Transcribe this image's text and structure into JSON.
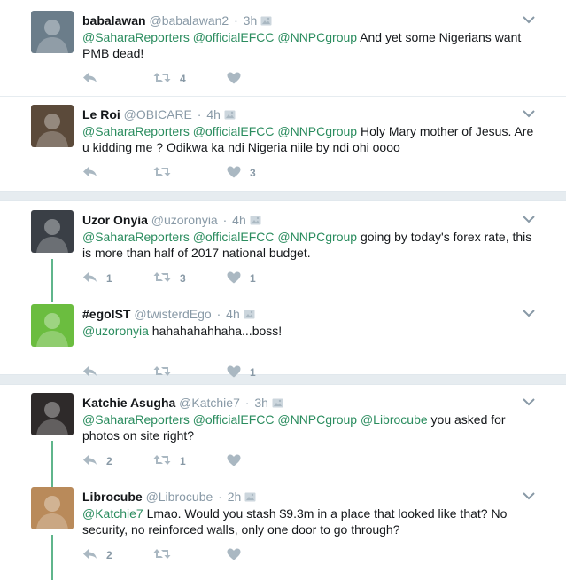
{
  "tweets": [
    {
      "name": "babalawan",
      "handle": "@babalawan2",
      "time": "3h",
      "segments": [
        [
          "m",
          "@SaharaReporters"
        ],
        [
          "t",
          " "
        ],
        [
          "m",
          "@officialEFCC"
        ],
        [
          "t",
          " "
        ],
        [
          "m",
          "@NNPCgroup"
        ],
        [
          "t",
          " And yet some Nigerians want PMB dead!"
        ]
      ],
      "reply_count": "",
      "retweet_count": "4",
      "like_count": ""
    },
    {
      "name": "Le Roi",
      "handle": "@OBICARE",
      "time": "4h",
      "segments": [
        [
          "m",
          "@SaharaReporters"
        ],
        [
          "t",
          " "
        ],
        [
          "m",
          "@officialEFCC"
        ],
        [
          "t",
          " "
        ],
        [
          "m",
          "@NNPCgroup"
        ],
        [
          "t",
          " Holy Mary mother of Jesus. Are u kidding me ? Odikwa ka ndi Nigeria niile by ndi ohi oooo"
        ]
      ],
      "reply_count": "",
      "retweet_count": "",
      "like_count": "3"
    },
    {
      "name": "Uzor Onyia",
      "handle": "@uzoronyia",
      "time": "4h",
      "segments": [
        [
          "m",
          "@SaharaReporters"
        ],
        [
          "t",
          " "
        ],
        [
          "m",
          "@officialEFCC"
        ],
        [
          "t",
          " "
        ],
        [
          "m",
          "@NNPCgroup"
        ],
        [
          "t",
          " going by today's forex rate, this is more than half of 2017 national budget."
        ]
      ],
      "reply_count": "1",
      "retweet_count": "3",
      "like_count": "1"
    },
    {
      "name": "#egoIST",
      "handle": "@twisterdEgo",
      "time": "4h",
      "segments": [
        [
          "m",
          "@uzoronyia"
        ],
        [
          "t",
          " hahahahahhaha...boss!"
        ]
      ],
      "reply_count": "",
      "retweet_count": "",
      "like_count": "1"
    },
    {
      "name": "Katchie Asugha",
      "handle": "@Katchie7",
      "time": "3h",
      "segments": [
        [
          "m",
          "@SaharaReporters"
        ],
        [
          "t",
          " "
        ],
        [
          "m",
          "@officialEFCC"
        ],
        [
          "t",
          " "
        ],
        [
          "m",
          "@NNPCgroup"
        ],
        [
          "t",
          " "
        ],
        [
          "m",
          "@Librocube"
        ],
        [
          "t",
          " you asked for photos on site right?"
        ]
      ],
      "reply_count": "2",
      "retweet_count": "1",
      "like_count": ""
    },
    {
      "name": "Librocube",
      "handle": "@Librocube",
      "time": "2h",
      "segments": [
        [
          "m",
          "@Katchie7"
        ],
        [
          "t",
          " Lmao. Would you stash $9.3m in a place that looked like that? No security, no reinforced walls, only one door to go through?"
        ]
      ],
      "reply_count": "2",
      "retweet_count": "",
      "like_count": ""
    }
  ],
  "colors": {
    "mention": "#2a8c5e",
    "thread_line": "#5fb58b",
    "icon": "#aab8c2",
    "meta": "#8899a6"
  },
  "icons": {
    "reply": "reply-icon",
    "retweet": "retweet-icon",
    "like": "heart-icon",
    "more": "chevron-down-icon",
    "media": "photo-icon"
  }
}
